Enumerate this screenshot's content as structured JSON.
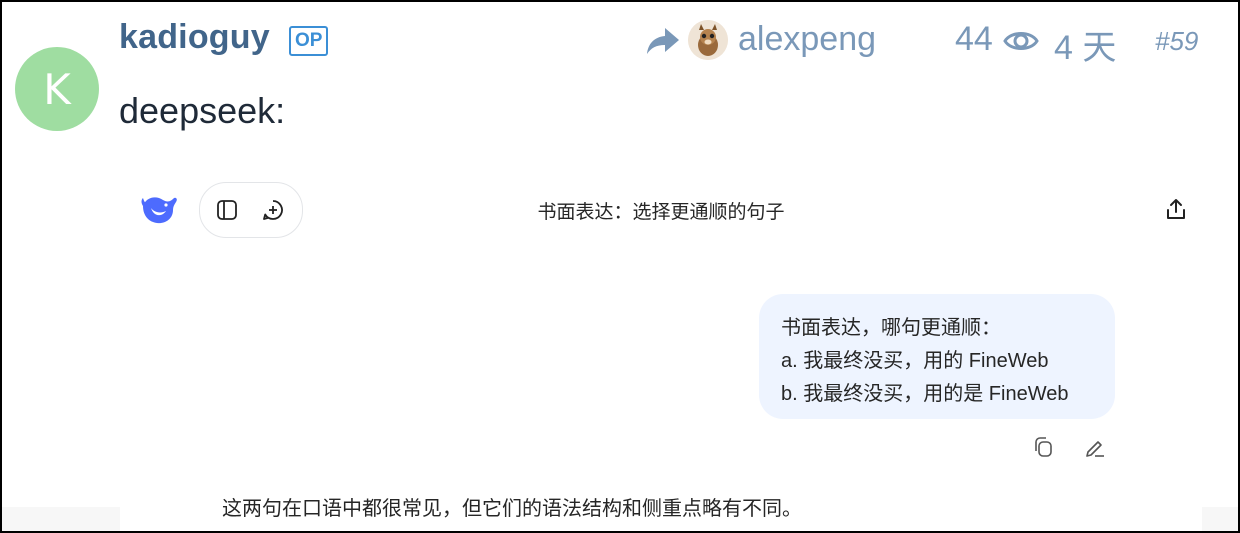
{
  "post": {
    "avatar_letter": "K",
    "avatar_color": "#9fdda1",
    "username": "kadioguy",
    "op_badge": "OP",
    "reply_to_user": "alexpeng",
    "views": "44",
    "age": "4 天",
    "post_number": "#59",
    "body_text": "deepseek:"
  },
  "screenshot": {
    "title": "书面表达：选择更通顺的句子",
    "user_message": {
      "lines": [
        "书面表达，哪句更通顺：",
        "a. 我最终没买，用的 FineWeb",
        "b. 我最终没买，用的是 FineWeb"
      ]
    },
    "assistant_message": "这两句在口语中都很常见，但它们的语法结构和侧重点略有不同。",
    "icons": {
      "logo": "deepseek-whale-logo",
      "sidebar": "sidebar-toggle-icon",
      "new_chat": "new-chat-icon",
      "share": "share-icon",
      "copy": "copy-icon",
      "edit": "edit-icon"
    }
  },
  "colors": {
    "username": "#41658a",
    "meta": "#7a98b8",
    "op_badge": "#3b8fd6",
    "bubble_bg": "#eef4ff",
    "deepseek_blue": "#4d6bfe"
  }
}
